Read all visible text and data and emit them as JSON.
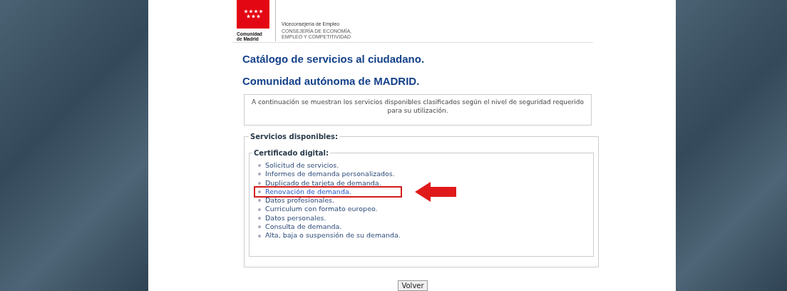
{
  "header": {
    "logo_text": [
      "Comunidad",
      "de Madrid"
    ],
    "department": "Viceconsejería de Empleo",
    "ministry": [
      "CONSEJERÍA DE ECONOMÍA,",
      "EMPLEO Y COMPETITIVIDAD"
    ]
  },
  "titles": [
    "Catálogo de servicios al ciudadano.",
    "Comunidad autónoma de MADRID."
  ],
  "intro": "A continuación se muestran los servicios disponibles clasificados según el nivel de seguridad requerido para su utilización.",
  "services": {
    "legend": "Servicios disponibles:",
    "group": {
      "legend": "Certificado digital:",
      "items": [
        {
          "label": "Solicitud de servicios.",
          "selected": false
        },
        {
          "label": "Informes de demanda personalizados.",
          "selected": false
        },
        {
          "label": "Duplicado de tarjeta de demanda.",
          "selected": false
        },
        {
          "label": "Renovación de demanda.",
          "selected": true
        },
        {
          "label": "Datos profesionales.",
          "selected": false
        },
        {
          "label": "Curriculum con formato europeo.",
          "selected": false
        },
        {
          "label": "Datos personales.",
          "selected": false
        },
        {
          "label": "Consulta de demanda.",
          "selected": false
        },
        {
          "label": "Alta, baja o suspensión de su demanda.",
          "selected": false
        }
      ]
    }
  },
  "back_button": "Volver"
}
